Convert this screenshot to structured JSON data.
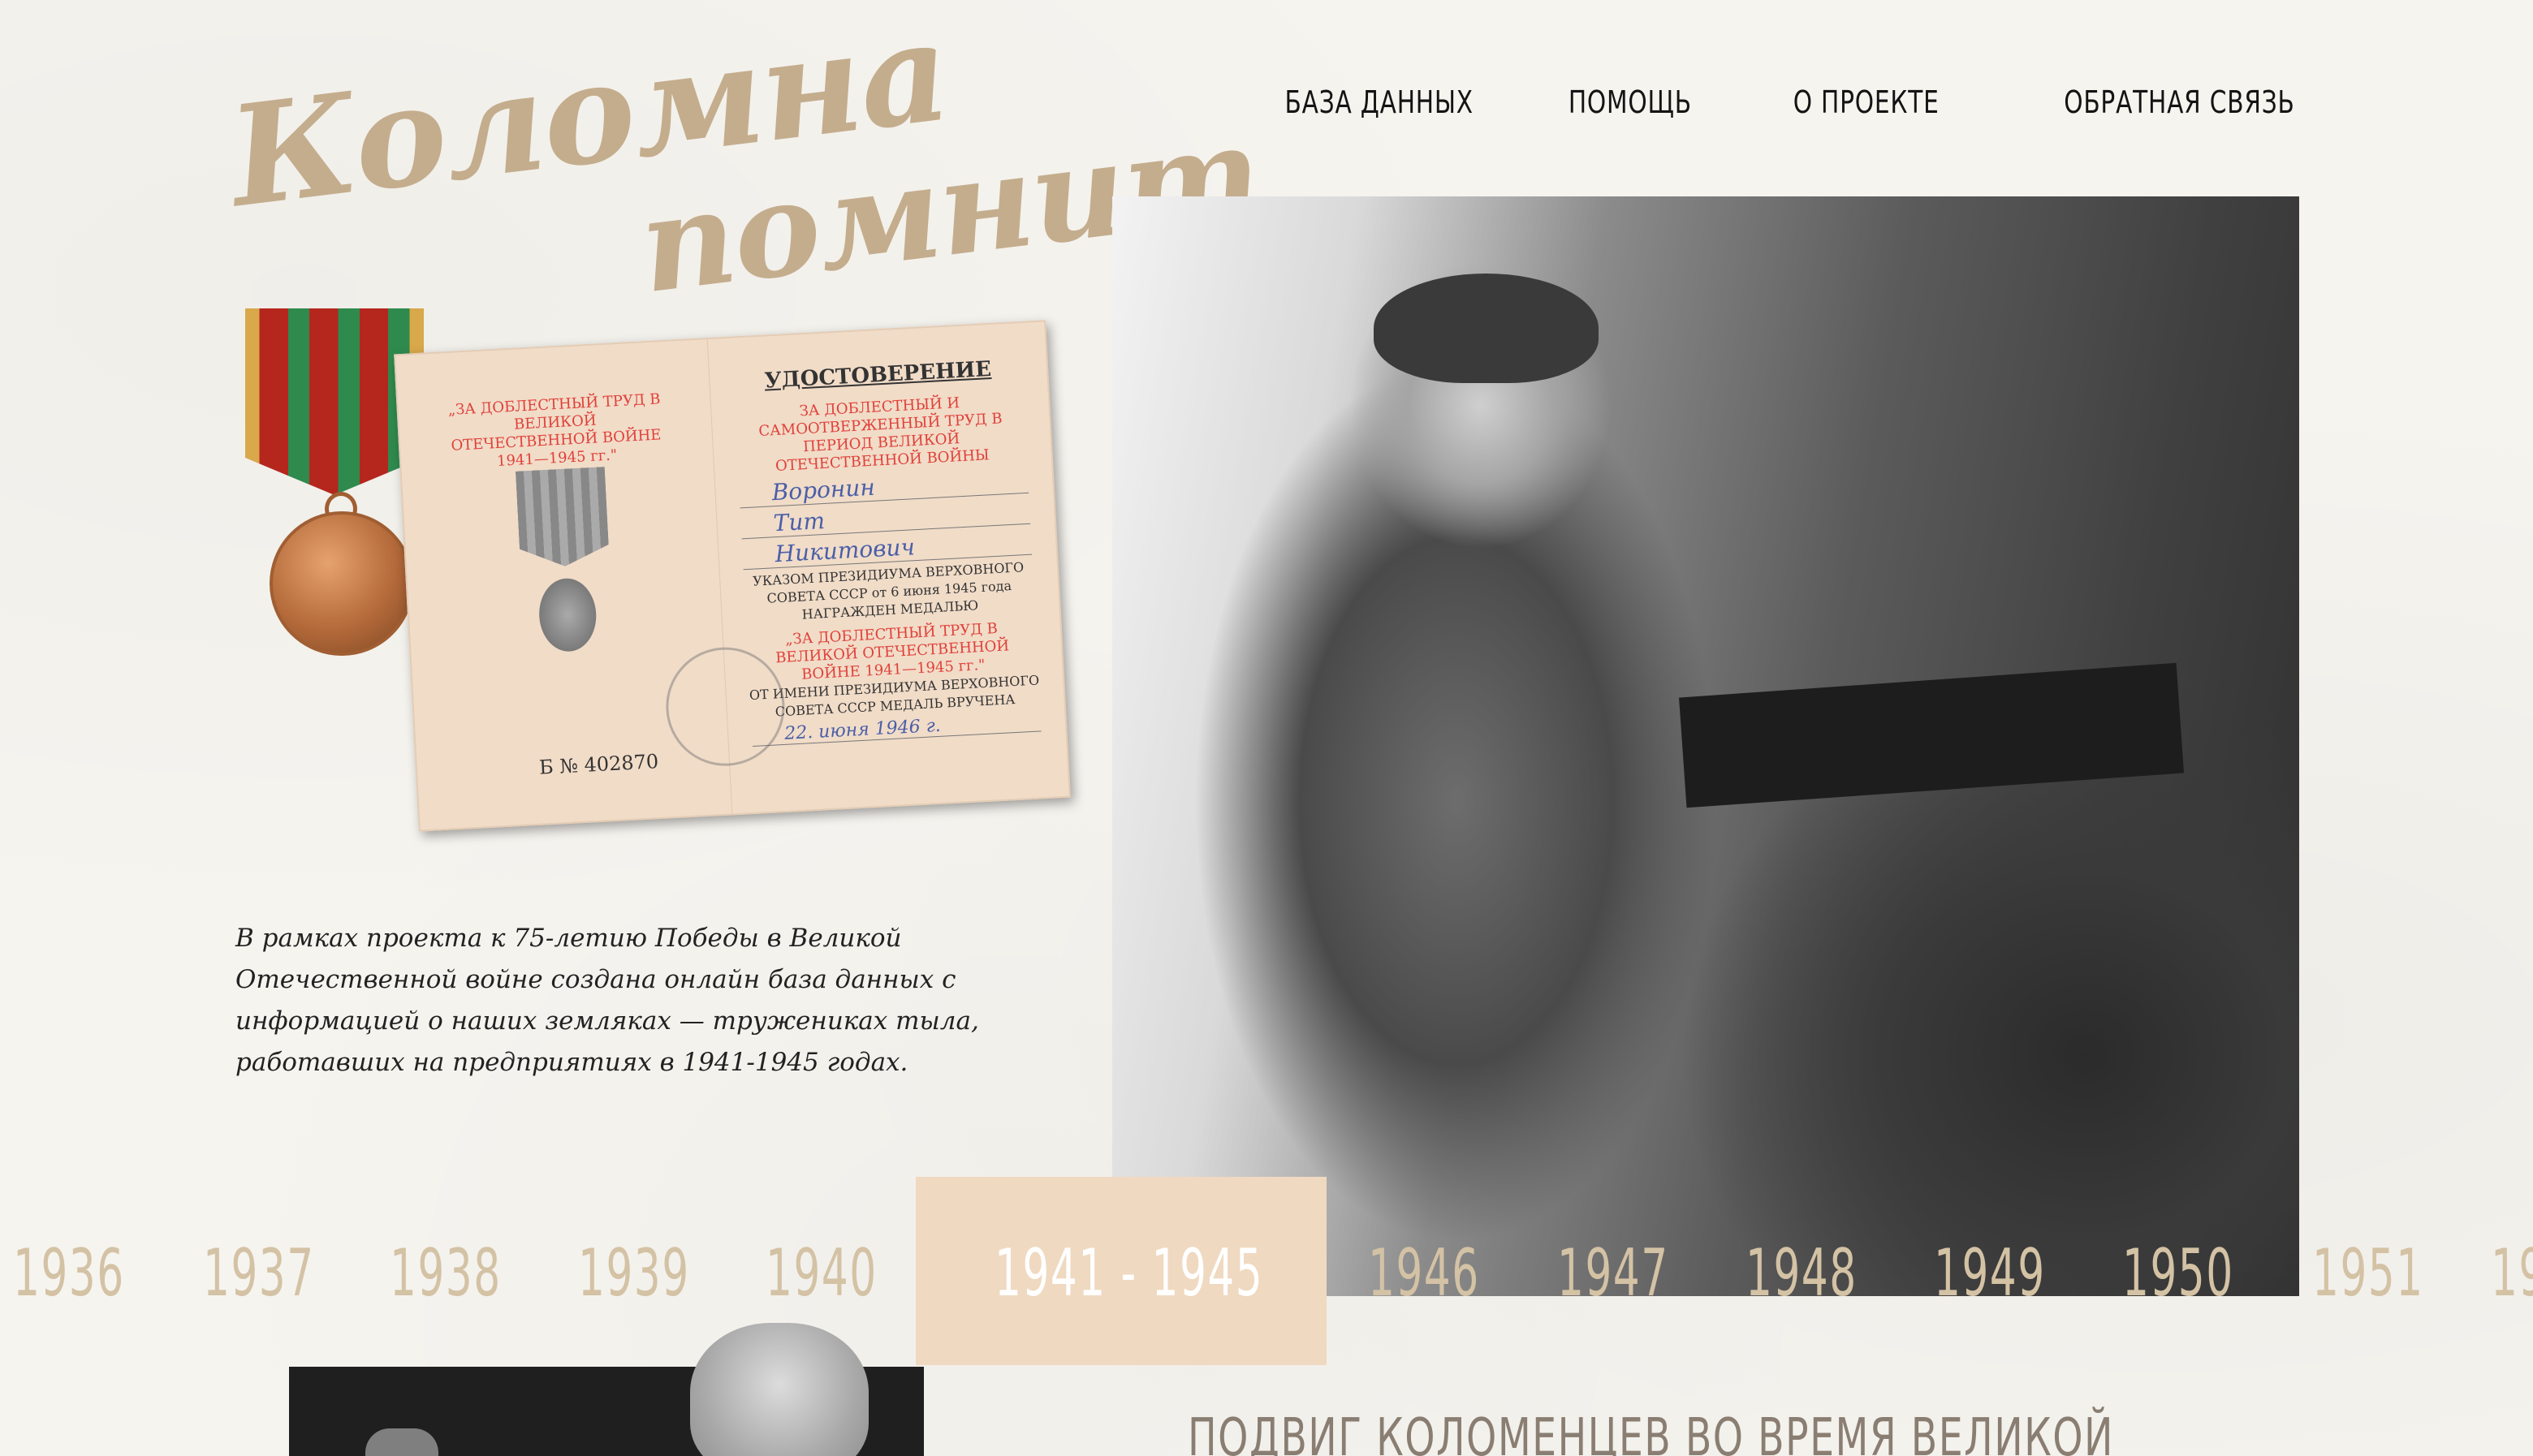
{
  "logo": {
    "line1": "Коломна",
    "line2": "помнит"
  },
  "nav": {
    "items": [
      "БАЗА ДАННЫХ",
      "ПОМОЩЬ",
      "О ПРОЕКТЕ",
      "ОБРАТНАЯ СВЯЗЬ"
    ]
  },
  "certificate": {
    "left_red": "„ЗА ДОБЛЕСТНЫЙ ТРУД В ВЕЛИКОЙ ОТЕЧЕСТВЕННОЙ ВОЙНЕ 1941—1945 гг.\"",
    "title": "УДОСТОВЕРЕНИЕ",
    "red_top": "ЗА ДОБЛЕСТНЫЙ И САМООТВЕРЖЕННЫЙ ТРУД В ПЕРИОД ВЕЛИКОЙ ОТЕЧЕСТВЕННОЙ ВОЙНЫ",
    "surname": "Воронин",
    "name": "Тит",
    "patronymic": "Никитович",
    "decree": "УКАЗОМ ПРЕЗИДИУМА ВЕРХОВНОГО СОВЕТА СССР от 6 июня 1945 года НАГРАЖДЕН МЕДАЛЬЮ",
    "red_bottom": "„ЗА ДОБЛЕСТНЫЙ ТРУД В ВЕЛИКОЙ ОТЕЧЕСТВЕННОЙ ВОЙНЕ 1941—1945 гг.\"",
    "issued": "ОТ ИМЕНИ ПРЕЗИДИУМА ВЕРХОВНОГО СОВЕТА СССР МЕДАЛЬ ВРУЧЕНА",
    "date": "22. июня 1946 г.",
    "number": "Б № 402870"
  },
  "intro": {
    "text": "В рамках проекта к 75-летию Победы в Великой Отечественной войне создана онлайн база данных с информацией о наших земляках — тружениках тыла, работавших на предприятиях в 1941-1945 годах."
  },
  "timeline": {
    "years": [
      "1936",
      "1937",
      "1938",
      "1939",
      "1940",
      "1941 - 1945",
      "1946",
      "1947",
      "1948",
      "1949",
      "1950",
      "1951",
      "19"
    ],
    "active": "1941 - 1945"
  },
  "section": {
    "title": "ПОДВИГ КОЛОМЕНЦЕВ ВО ВРЕМЯ ВЕЛИКОЙ"
  }
}
